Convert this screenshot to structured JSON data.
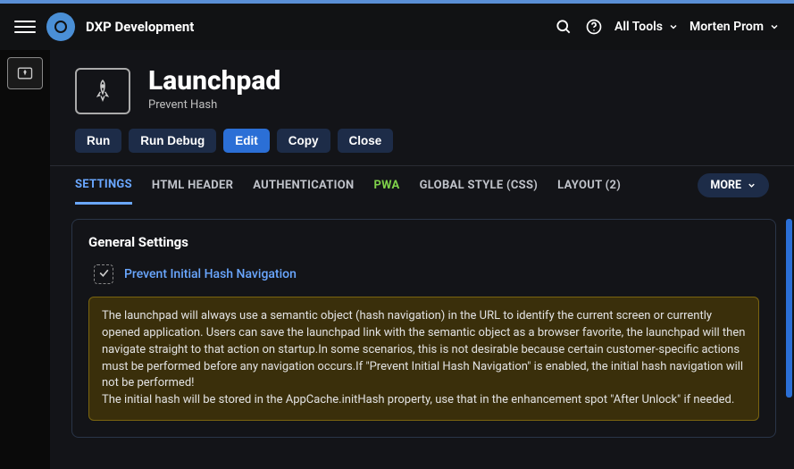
{
  "header": {
    "app_title": "DXP Development",
    "all_tools": "All Tools",
    "user_name": "Morten Prom"
  },
  "page": {
    "title": "Launchpad",
    "subtitle": "Prevent Hash"
  },
  "actions": {
    "run": "Run",
    "run_debug": "Run Debug",
    "edit": "Edit",
    "copy": "Copy",
    "close": "Close"
  },
  "tabs": {
    "settings": "SETTINGS",
    "html_header": "HTML HEADER",
    "authentication": "AUTHENTICATION",
    "pwa": "PWA",
    "global_style": "GLOBAL STYLE (CSS)",
    "layout": "LAYOUT (2)",
    "more": "MORE"
  },
  "panel": {
    "heading": "General Settings",
    "checkbox_label": "Prevent Initial Hash Navigation",
    "note_p1": "The launchpad will always use a semantic object (hash navigation) in the URL to identify the current screen or currently opened application. Users can save the launchpad link with the semantic object as a browser favorite, the launchpad will then navigate straight to that action on startup.In some scenarios, this is not desirable because certain customer-specific actions must be performed before any navigation occurs.If \"Prevent Initial Hash Navigation\" is enabled, the initial hash navigation will not be performed!",
    "note_p2": "The initial hash will be stored in the AppCache.initHash property, use that in the enhancement spot \"After Unlock\" if needed."
  }
}
